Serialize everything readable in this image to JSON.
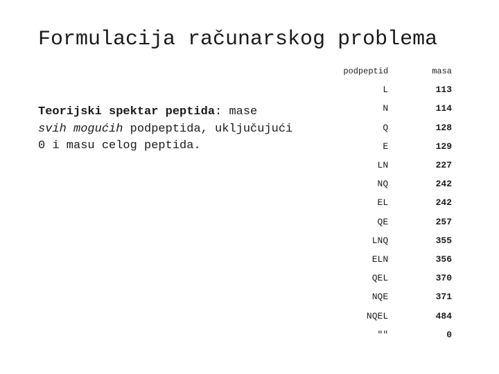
{
  "title": "Formulacija računarskog problema",
  "para": {
    "lead_bold": "Teorijski spektar peptida",
    "after_colon": ": mase",
    "line2_italic": "svih mogućih",
    "line2_rest": " podpeptida, uključujući",
    "line3": "0 i masu celog peptida."
  },
  "table": {
    "headers": {
      "c1": "podpeptid",
      "c2": "masa"
    },
    "rows": [
      {
        "p": "L",
        "m": "113"
      },
      {
        "p": "N",
        "m": "114"
      },
      {
        "p": "Q",
        "m": "128"
      },
      {
        "p": "E",
        "m": "129"
      },
      {
        "p": "LN",
        "m": "227"
      },
      {
        "p": "NQ",
        "m": "242"
      },
      {
        "p": "EL",
        "m": "242"
      },
      {
        "p": "QE",
        "m": "257"
      },
      {
        "p": "LNQ",
        "m": "355"
      },
      {
        "p": "ELN",
        "m": "356"
      },
      {
        "p": "QEL",
        "m": "370"
      },
      {
        "p": "NQE",
        "m": "371"
      },
      {
        "p": "NQEL",
        "m": "484"
      },
      {
        "p": "\"\"",
        "m": "0"
      }
    ]
  }
}
